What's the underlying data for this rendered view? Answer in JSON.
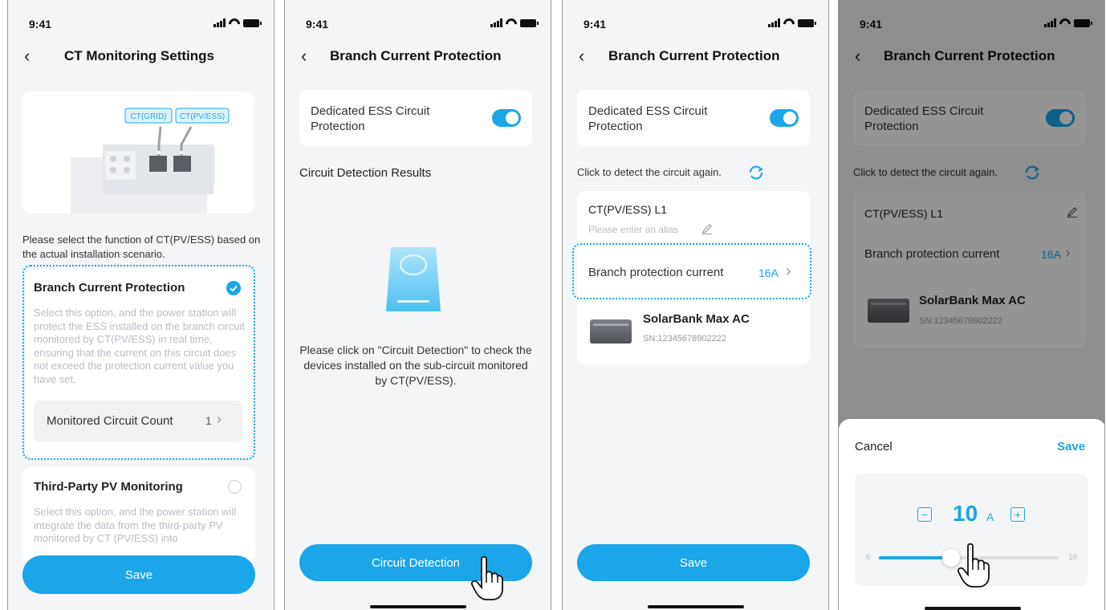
{
  "status_time": "9:41",
  "accent_color": "#1aa6e8",
  "s1": {
    "title": "CT Monitoring Settings",
    "ct_grid_label": "CT(GRID)",
    "ct_pvess_label": "CT(PV/ESS)",
    "instruction": "Please select the function of CT(PV/ESS) based on the actual installation scenario.",
    "opt1_title": "Branch Current Protection",
    "opt1_desc": "Select this option, and the power station will protect the ESS installed on the branch circuit monitored by CT(PV/ESS) in real time, ensuring that the current on this circuit does not exceed the protection current value you have set.",
    "monitored_label": "Monitored Circuit Count",
    "monitored_value": "1",
    "opt2_title": "Third-Party PV Monitoring",
    "opt2_desc": "Select this option, and the power station will integrate the data from the third-party PV monitored by CT (PV/ESS) into",
    "save_label": "Save"
  },
  "s2": {
    "title": "Branch Current Protection",
    "toggle_label": "Dedicated ESS Circuit Protection",
    "results_heading": "Circuit Detection Results",
    "empty_text": "Please click on \"Circuit Detection\" to check the devices installed on the sub-circuit monitored by CT(PV/ESS).",
    "detect_button": "Circuit Detection"
  },
  "s3": {
    "title": "Branch Current Protection",
    "toggle_label": "Dedicated ESS Circuit Protection",
    "redetect_text": "Click to detect the circuit again.",
    "ct_name": "CT(PV/ESS) L1",
    "alias_placeholder": "Please enter an alias",
    "protect_label": "Branch protection current",
    "protect_value": "16A",
    "device_name": "SolarBank Max AC",
    "device_sn": "SN:12345678902222",
    "save_label": "Save"
  },
  "s4": {
    "title": "Branch Current Protection",
    "toggle_label": "Dedicated ESS Circuit Protection",
    "redetect_text": "Click to detect the circuit again.",
    "ct_name": "CT(PV/ESS) L1",
    "protect_label": "Branch protection current",
    "protect_value": "16A",
    "device_name": "SolarBank Max AC",
    "device_sn": "SN:12345678902222",
    "sheet_cancel": "Cancel",
    "sheet_save": "Save",
    "value": "10",
    "unit": "A",
    "slider_min": "6",
    "slider_max": "16",
    "slider_current": 10
  }
}
